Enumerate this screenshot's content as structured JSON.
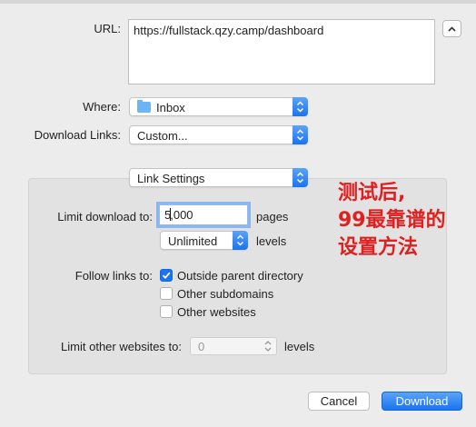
{
  "labels": {
    "url": "URL:",
    "where": "Where:",
    "download_links": "Download Links:",
    "limit_download": "Limit download to:",
    "pages": "pages",
    "levels": "levels",
    "follow_links": "Follow links to:",
    "limit_other": "Limit other websites to:",
    "levels2": "levels"
  },
  "url_value": "https://fullstack.qzy.camp/dashboard",
  "where_value": "Inbox",
  "download_links_value": "Custom...",
  "link_settings_value": "Link Settings",
  "limit_download_value_before_cursor": "5",
  "limit_download_value_after_cursor": ",000",
  "levels_value": "Unlimited",
  "follow_options": [
    {
      "label": "Outside parent directory",
      "checked": true
    },
    {
      "label": "Other subdomains",
      "checked": false
    },
    {
      "label": "Other websites",
      "checked": false
    }
  ],
  "limit_other_value": "0",
  "annotation_lines": [
    "测试后,",
    "99最靠谱的",
    "设置方法"
  ],
  "buttons": {
    "cancel": "Cancel",
    "download": "Download"
  },
  "icons": {
    "where": "folder-icon",
    "expand": "chevron-up-icon",
    "popup": "updown-arrows-icon",
    "check": "checkmark-icon"
  },
  "colors": {
    "accent": "#1a74f0",
    "annotation": "#e02020"
  }
}
